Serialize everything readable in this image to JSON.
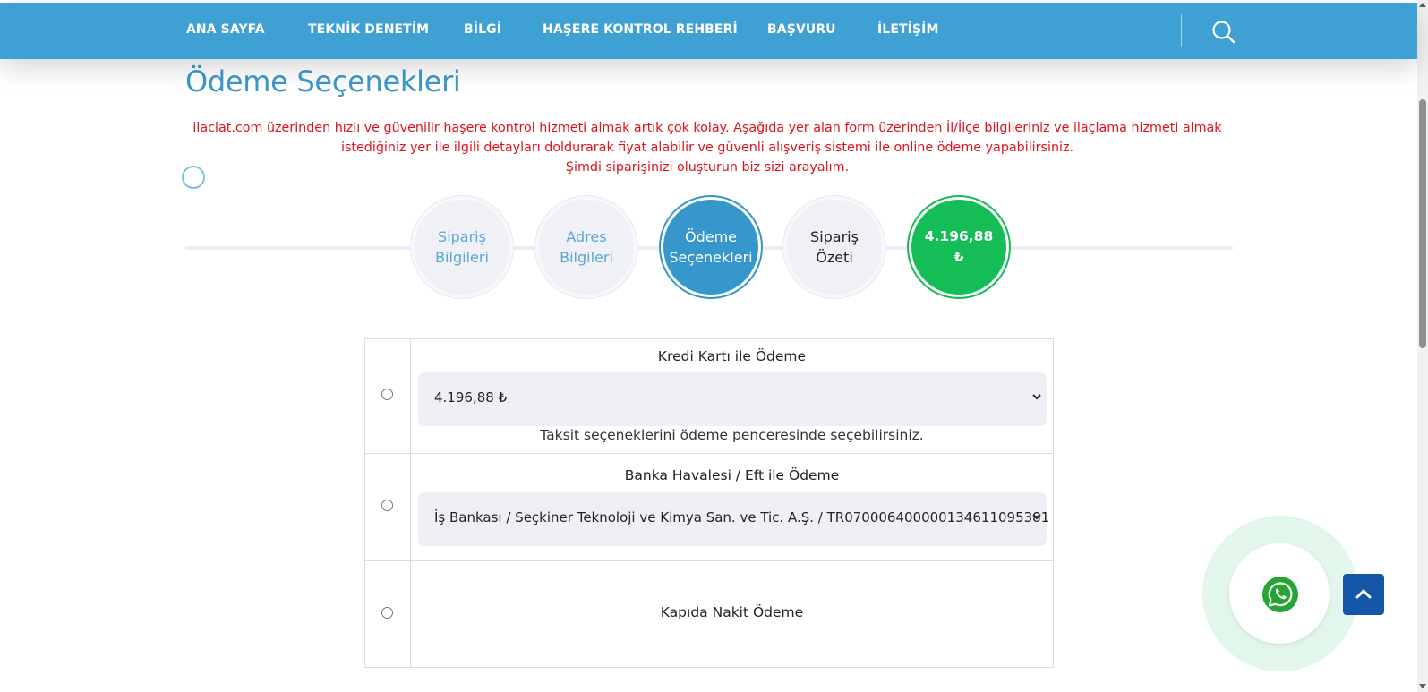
{
  "nav": {
    "items": [
      {
        "label": "ANA SAYFA"
      },
      {
        "label": "TEKNİK DENETİM"
      },
      {
        "label": "BİLGİ"
      },
      {
        "label": "HAŞERE KONTROL REHBERİ"
      },
      {
        "label": "BAŞVURU"
      },
      {
        "label": "İLETİŞİM"
      }
    ],
    "search_icon": "search-icon",
    "bg_color": "#3fa1d3"
  },
  "page": {
    "title": "Ödeme Seçenekleri",
    "intro_lines": [
      "ilaclat.com üzerinden hızlı ve güvenilir haşere kontrol hizmeti almak artık çok kolay. Aşağıda yer alan form üzerinden İl/İlçe bilgileriniz ve ilaçlama hizmeti almak",
      "istediğiniz yer ile ilgili detayları doldurarak fiyat alabilir ve güvenli alışveriş sistemi ile online ödeme yapabilirsiniz.",
      "Şimdi siparişinizi oluşturun biz sizi arayalım."
    ],
    "intro_color": "#e0111b"
  },
  "steps": [
    {
      "line1": "Sipariş",
      "line2": "Bilgileri",
      "state": "inactive"
    },
    {
      "line1": "Adres",
      "line2": "Bilgileri",
      "state": "inactive"
    },
    {
      "line1": "Ödeme",
      "line2": "Seçenekleri",
      "state": "active"
    },
    {
      "line1": "Sipariş",
      "line2": "Özeti",
      "state": "upcoming"
    },
    {
      "line1": "4.196,88",
      "line2": "₺",
      "state": "total"
    }
  ],
  "payment": {
    "credit_card": {
      "title": "Kredi Kartı ile Ödeme",
      "selected": "4.196,88 ₺",
      "note": "Taksit seçeneklerini ödeme penceresinde seçebilirsiniz."
    },
    "bank_transfer": {
      "title": "Banka Havalesi / Eft ile Ödeme",
      "selected": "İş Bankası / Seçkiner Teknoloji ve Kimya San. ve Tic. A.Ş. / TR070006400000134611095381"
    },
    "cash_on_delivery": {
      "title": "Kapıda Nakit Ödeme"
    }
  },
  "floating": {
    "whatsapp_icon": "whatsapp-icon",
    "back_to_top_icon": "chevron-up-icon"
  },
  "colors": {
    "accent": "#3597cc",
    "success": "#14bd55",
    "title": "#3d99c9",
    "back_to_top": "#1656a8"
  }
}
